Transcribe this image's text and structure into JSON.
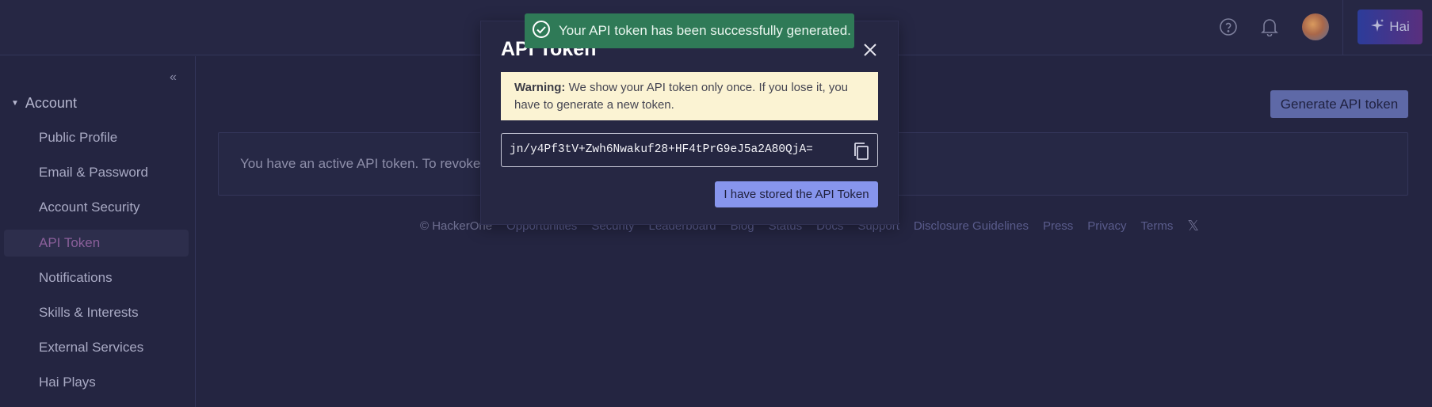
{
  "topbar": {
    "help_icon": "question-circle-icon",
    "bell_icon": "bell-icon",
    "hai_label": "Hai",
    "hai_icon": "sparkle-icon"
  },
  "sidebar": {
    "collapse_icon": "chevrons-left-icon",
    "section_label": "Account",
    "items": [
      {
        "label": "Public Profile"
      },
      {
        "label": "Email & Password"
      },
      {
        "label": "Account Security"
      },
      {
        "label": "API Token",
        "active": true
      },
      {
        "label": "Notifications"
      },
      {
        "label": "Skills & Interests"
      },
      {
        "label": "External Services"
      },
      {
        "label": "Hai Plays"
      }
    ]
  },
  "main": {
    "generate_button": "Generate API token",
    "info_text": "You have an active API token. To revoke t"
  },
  "footer": {
    "copyright": "© HackerOne",
    "links": [
      "Opportunities",
      "Security",
      "Leaderboard",
      "Blog",
      "Status",
      "Docs",
      "Support",
      "Disclosure Guidelines",
      "Press",
      "Privacy",
      "Terms"
    ],
    "social_icon": "x-logo-icon"
  },
  "modal": {
    "title": "API Token",
    "close_icon": "close-icon",
    "warning_label": "Warning:",
    "warning_text": " We show your API token only once. If you lose it, you have to generate a new token.",
    "token": "jn/y4Pf3tV+Zwh6Nwakuf28+HF4tPrG9eJ5a2A80QjA=",
    "copy_icon": "copy-icon",
    "confirm_button": "I have stored the API Token"
  },
  "toast": {
    "icon": "check-circle-icon",
    "message": "Your API token has been successfully generated."
  },
  "colors": {
    "background": "#242541",
    "toast": "#2f7a57",
    "warning_bg": "#fbf3d3",
    "primary_button": "#8795ed",
    "active_nav": "#8a5f9a"
  }
}
